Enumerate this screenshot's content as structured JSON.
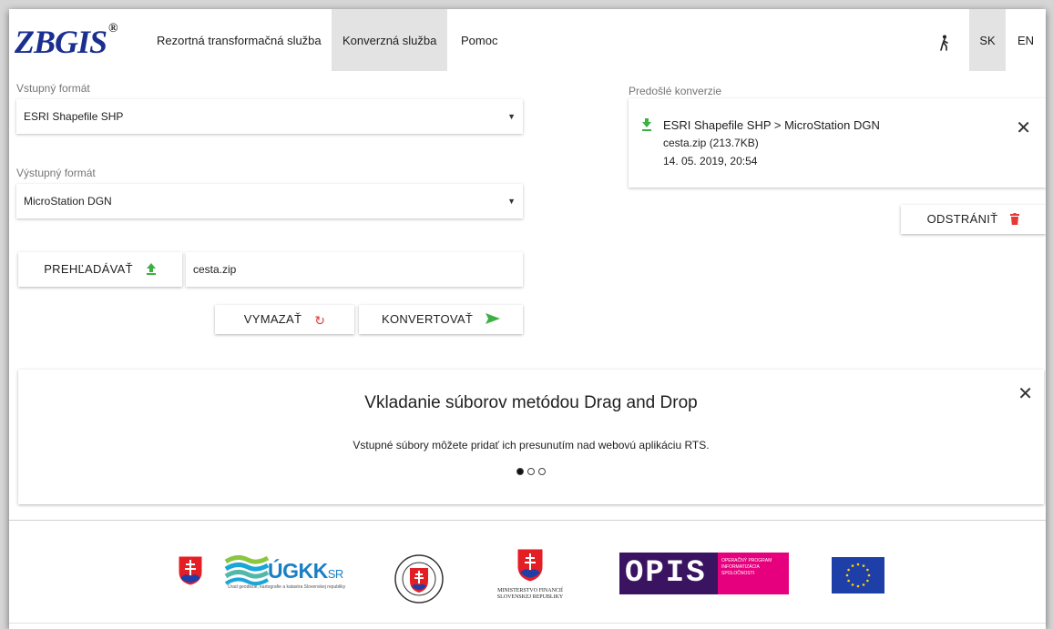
{
  "header": {
    "logo_text_z": "Z",
    "logo_text_rest": "BGIS",
    "logo_reg": "®",
    "nav": [
      {
        "label": "Rezortná transformačná služba",
        "active": false
      },
      {
        "label": "Konverzná služba",
        "active": true
      },
      {
        "label": "Pomoc",
        "active": false
      }
    ],
    "accessibility_icon": "walking-person-icon",
    "lang_sk": "SK",
    "lang_en": "EN"
  },
  "form": {
    "input_format_label": "Vstupný formát",
    "input_format_value": "ESRI Shapefile SHP",
    "output_format_label": "Výstupný formát",
    "output_format_value": "MicroStation DGN",
    "browse_label": "PREHĽADÁVAŤ",
    "file_value": "cesta.zip",
    "clear_label": "VYMAZAŤ",
    "convert_label": "KONVERTOVAŤ"
  },
  "previous": {
    "title": "Predošlé konverzie",
    "items": [
      {
        "name": "ESRI Shapefile SHP > MicroStation DGN",
        "file": "cesta.zip (213.7KB)",
        "date": "14. 05. 2019, 20:54"
      }
    ],
    "delete_label": "ODSTRÁNIŤ"
  },
  "banner": {
    "title": "Vkladanie súborov metódou Drag and Drop",
    "text": "Vstupné súbory môžete pridať ich presunutím nad webovú aplikáciu RTS."
  },
  "footer": {
    "ugkk_text": "ÚGKK",
    "ugkk_sr": "SR",
    "ugkk_sub": "Úrad geodézie, kartografie a katastra Slovenskej republiky",
    "mf_text": "MINISTERSTVO FINANCIÍ SLOVENSKEJ REPUBLIKY",
    "opis_text": "OPIS",
    "opis_sub": "OPERAČNÝ PROGRAM INFORMATIZÁCIA SPOLOČNOSTI"
  },
  "colors": {
    "accent_green": "#3cb043",
    "accent_red": "#e53935",
    "logo_blue": "#1b2f8f",
    "opis_purple": "#3a1460",
    "opis_pink": "#e6007e",
    "eu_blue": "#1f3fa8"
  }
}
